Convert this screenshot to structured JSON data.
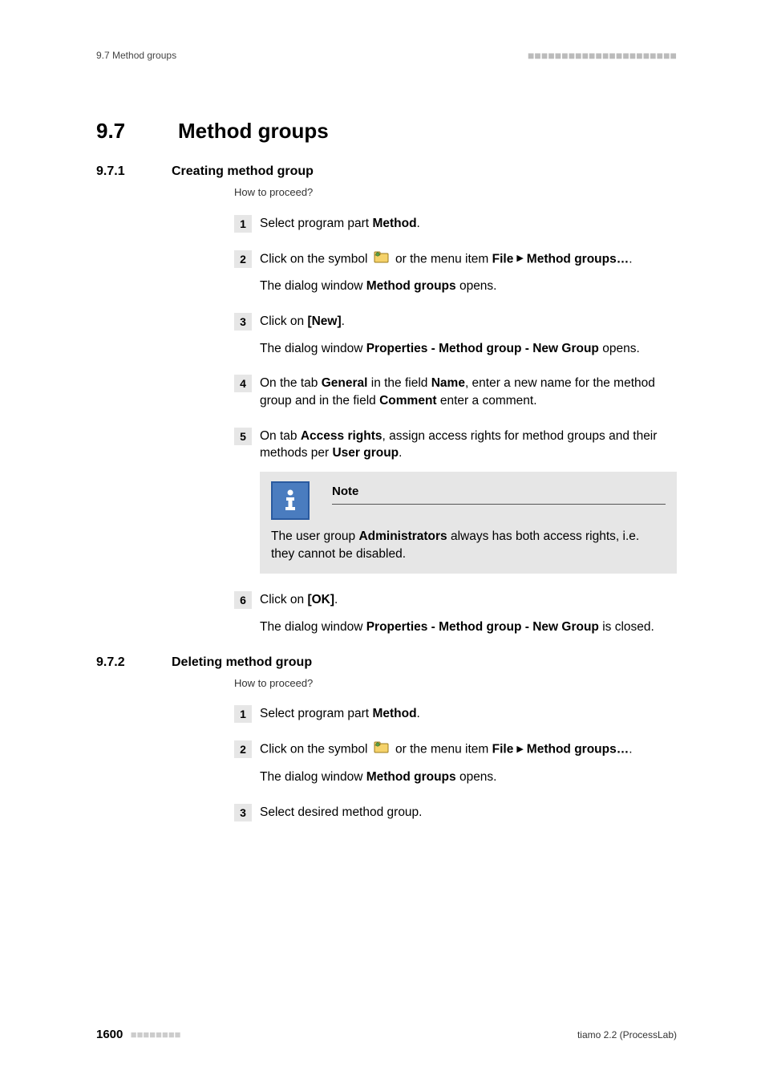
{
  "header": {
    "left": "9.7 Method groups",
    "dashes": "■■■■■■■■■■■■■■■■■■■■■■"
  },
  "h1": {
    "num": "9.7",
    "title": "Method groups"
  },
  "sectionA": {
    "num": "9.7.1",
    "title": "Creating method group",
    "howto": "How to proceed?"
  },
  "stepsA": {
    "s1_a": "Select program part ",
    "s1_b": "Method",
    "s1_c": ".",
    "s2_a": "Click on the symbol ",
    "s2_b": " or the menu item ",
    "s2_file": "File",
    "s2_mg": "Method groups…",
    "s2_d": ".",
    "s2_open_a": "The dialog window ",
    "s2_open_b": "Method groups",
    "s2_open_c": " opens.",
    "s3_a": "Click on ",
    "s3_b": "[New]",
    "s3_c": ".",
    "s3_open_a": "The dialog window ",
    "s3_open_b": "Properties - Method group - New Group",
    "s3_open_c": " opens.",
    "s4_a": "On the tab ",
    "s4_b": "General",
    "s4_c": " in the field ",
    "s4_d": "Name",
    "s4_e": ", enter a new name for the method group and in the field ",
    "s4_f": "Comment",
    "s4_g": " enter a comment.",
    "s5_a": "On tab ",
    "s5_b": "Access rights",
    "s5_c": ", assign access rights for method groups and their methods per ",
    "s5_d": "User group",
    "s5_e": ".",
    "note_title": "Note",
    "note_a": "The user group ",
    "note_b": "Administrators",
    "note_c": " always has both access rights, i.e. they cannot be disabled.",
    "s6_a": "Click on ",
    "s6_b": "[OK]",
    "s6_c": ".",
    "s6_close_a": "The dialog window ",
    "s6_close_b": "Properties - Method group - New Group",
    "s6_close_c": " is closed."
  },
  "sectionB": {
    "num": "9.7.2",
    "title": "Deleting method group",
    "howto": "How to proceed?"
  },
  "stepsB": {
    "s1_a": "Select program part ",
    "s1_b": "Method",
    "s1_c": ".",
    "s2_a": "Click on the symbol ",
    "s2_b": " or the menu item ",
    "s2_file": "File",
    "s2_mg": "Method groups…",
    "s2_d": ".",
    "s2_open_a": "The dialog window ",
    "s2_open_b": "Method groups",
    "s2_open_c": " opens.",
    "s3": "Select desired method group."
  },
  "footer": {
    "page": "1600",
    "dashes": "■■■■■■■■",
    "product": "tiamo 2.2 (ProcessLab)"
  },
  "nums": {
    "n1": "1",
    "n2": "2",
    "n3": "3",
    "n4": "4",
    "n5": "5",
    "n6": "6"
  }
}
